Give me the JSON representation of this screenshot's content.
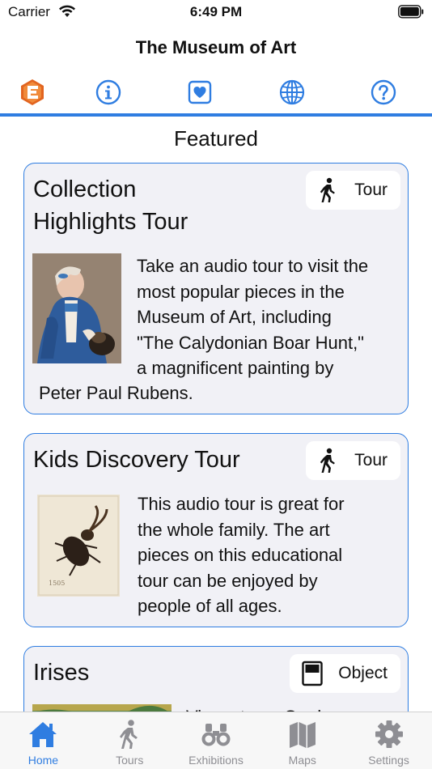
{
  "status": {
    "carrier": "Carrier",
    "time": "6:49 PM"
  },
  "header": {
    "title": "The Museum of Art"
  },
  "icon_tabs": [
    {
      "icon": "app-logo-icon"
    },
    {
      "icon": "info-icon"
    },
    {
      "icon": "heart-icon"
    },
    {
      "icon": "globe-icon"
    },
    {
      "icon": "help-icon"
    }
  ],
  "section": {
    "title": "Featured"
  },
  "cards": [
    {
      "title_lines": [
        "Collection",
        "Highlights Tour"
      ],
      "badge_label": "Tour",
      "badge_icon": "walking-person-icon",
      "desc_lines": [
        "Take an audio tour to visit the",
        "most popular pieces in the",
        "Museum of Art, including",
        "\"The Calydonian Boar Hunt,\"",
        "a magnificent painting by",
        "Peter Paul Rubens."
      ]
    },
    {
      "title_lines": [
        "Kids Discovery Tour"
      ],
      "badge_label": "Tour",
      "badge_icon": "walking-person-icon",
      "desc_lines": [
        "This audio tour is great for",
        "the whole family. The art",
        "pieces on this educational",
        "tour can be enjoyed by",
        "people of all ages."
      ]
    },
    {
      "title_lines": [
        "Irises"
      ],
      "badge_label": "Object",
      "badge_icon": "object-card-icon",
      "desc_lines": [
        "Vincent van Gogh"
      ]
    }
  ],
  "bottom_tabs": [
    {
      "label": "Home",
      "icon": "home-icon",
      "active": true
    },
    {
      "label": "Tours",
      "icon": "walking-person-icon",
      "active": false
    },
    {
      "label": "Exhibitions",
      "icon": "binoculars-icon",
      "active": false
    },
    {
      "label": "Maps",
      "icon": "map-icon",
      "active": false
    },
    {
      "label": "Settings",
      "icon": "gear-icon",
      "active": false
    }
  ],
  "colors": {
    "accent": "#2f7de1",
    "card_bg": "#f1f1f6",
    "inactive": "#8e8e93"
  }
}
